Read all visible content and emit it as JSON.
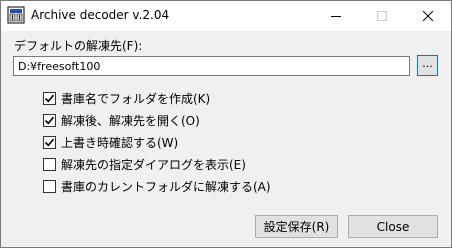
{
  "window": {
    "title": "Archive decoder v.2.04"
  },
  "destination": {
    "label": "デフォルトの解凍先(F):",
    "path": "D:¥freesoft100",
    "browse_label": "..."
  },
  "options": [
    {
      "label": "書庫名でフォルダを作成(K)",
      "checked": true
    },
    {
      "label": "解凍後、解凍先を開く(O)",
      "checked": true
    },
    {
      "label": "上書き時確認する(W)",
      "checked": true
    },
    {
      "label": "解凍先の指定ダイアログを表示(E)",
      "checked": false
    },
    {
      "label": "書庫のカレントフォルダに解凍する(A)",
      "checked": false
    }
  ],
  "buttons": {
    "save_label": "設定保存(R)",
    "close_label": "Close"
  },
  "colors": {
    "focus_border": "#0078d7",
    "window_bg": "#f0f0f0",
    "titlebar_bg": "#ffffff"
  }
}
